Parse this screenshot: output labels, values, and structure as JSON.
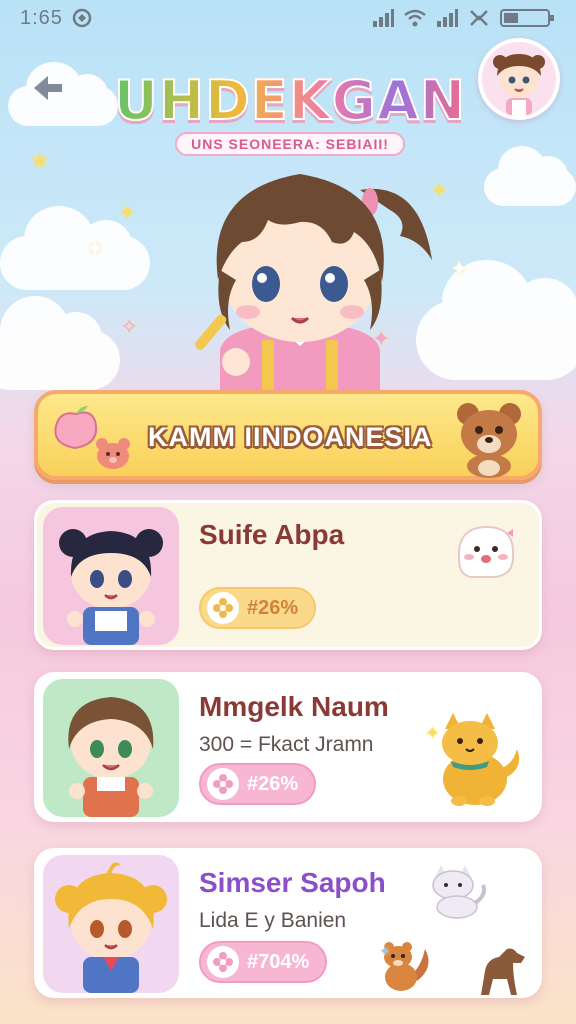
{
  "status_bar": {
    "time": "1:65",
    "icons": [
      "signal-icon",
      "wifi-icon",
      "signal-icon",
      "network-icon",
      "battery-icon"
    ]
  },
  "header": {
    "logo_title": "UHDEKGAN",
    "logo_subtitle": "UNS SEONEERA: SEBIAII!"
  },
  "banner": {
    "label": "KAMM IINDOANESIA"
  },
  "cards": [
    {
      "title": "Suife Abpa",
      "subtitle": "",
      "badge": "#26%"
    },
    {
      "title": "Mmgelk Naum",
      "subtitle": "300 = Fkact Jramn",
      "badge": "#26%"
    },
    {
      "title": "Simser Sapoh",
      "subtitle": "Lida E y Banien",
      "badge": "#704%"
    }
  ],
  "colors": {
    "accent_pink": "#f7b6d2",
    "accent_yellow": "#f9d15a",
    "title_brown": "#8a3a34",
    "title_purple": "#8a4fc9"
  }
}
